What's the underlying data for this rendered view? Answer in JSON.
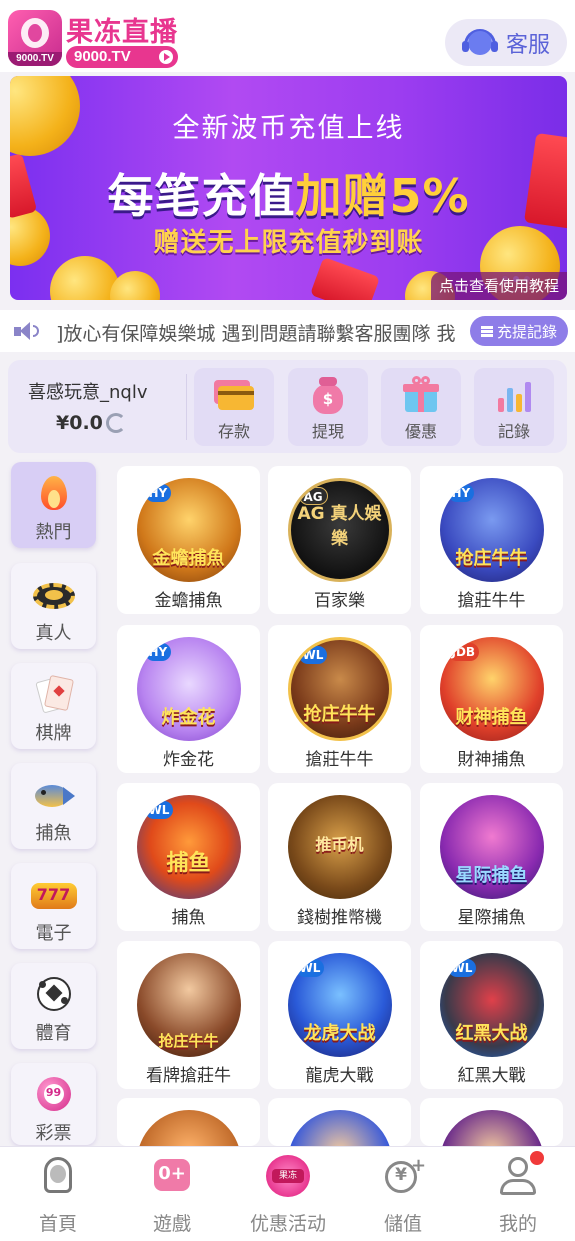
{
  "header": {
    "logo_tag": "9000.TV",
    "logo_title": "果冻直播",
    "logo_subtitle": "9000.TV",
    "customer_service_label": "客服"
  },
  "banner": {
    "line1": "全新波币充值上线",
    "line2_a": "每笔充值",
    "line2_b": "加赠5%",
    "line3": "赠送无上限充值秒到账",
    "link": "点击查看使用教程"
  },
  "marquee": {
    "text": "]放心有保障娛樂城  遇到問題請聯繫客服團隊 我",
    "record_button": "充提記錄"
  },
  "user": {
    "name": "喜感玩意_nqlv",
    "balance": "¥0.0"
  },
  "actions": [
    {
      "label": "存款",
      "icon": "deposit-card-icon"
    },
    {
      "label": "提現",
      "icon": "withdraw-bag-icon"
    },
    {
      "label": "優惠",
      "icon": "gift-icon"
    },
    {
      "label": "記錄",
      "icon": "bar-chart-icon"
    }
  ],
  "categories": [
    {
      "label": "熱門",
      "icon": "flame-icon"
    },
    {
      "label": "真人",
      "icon": "poker-chip-icon"
    },
    {
      "label": "棋牌",
      "icon": "playing-card-icon"
    },
    {
      "label": "捕魚",
      "icon": "shark-icon"
    },
    {
      "label": "電子",
      "icon": "slot-777-icon"
    },
    {
      "label": "體育",
      "icon": "soccer-ball-icon"
    },
    {
      "label": "彩票",
      "icon": "lottery-ball-icon"
    }
  ],
  "games": [
    {
      "name": "金蟾捕魚",
      "badge": "HY",
      "art_title": "金蟾捕魚"
    },
    {
      "name": "百家樂",
      "badge": "AG",
      "art_title": "AG 真人娛樂"
    },
    {
      "name": "搶莊牛牛",
      "badge": "HY",
      "art_title": "抢庄牛牛"
    },
    {
      "name": "炸金花",
      "badge": "HY",
      "art_title": "炸金花"
    },
    {
      "name": "搶莊牛牛",
      "badge": "WL",
      "art_title": "抢庄牛牛"
    },
    {
      "name": "財神捕魚",
      "badge": "JDB",
      "art_title": "财神捕鱼"
    },
    {
      "name": "捕魚",
      "badge": "WL",
      "art_title": "捕鱼"
    },
    {
      "name": "錢樹推幣機",
      "badge": "",
      "art_title": "推币机"
    },
    {
      "name": "星際捕魚",
      "badge": "",
      "art_title": "星际捕鱼"
    },
    {
      "name": "看牌搶莊牛",
      "badge": "",
      "art_title": "抢庄牛牛"
    },
    {
      "name": "龍虎大戰",
      "badge": "WL",
      "art_title": "龙虎大战"
    },
    {
      "name": "紅黑大戰",
      "badge": "WL",
      "art_title": "红黑大战"
    }
  ],
  "bottom_nav": [
    {
      "label": "首頁",
      "icon": "home-portrait-icon"
    },
    {
      "label": "遊戲",
      "icon": "gamepad-icon"
    },
    {
      "label": "优惠活动",
      "icon": "promo-logo-icon"
    },
    {
      "label": "儲值",
      "icon": "yuan-plus-icon"
    },
    {
      "label": "我的",
      "icon": "user-icon"
    }
  ],
  "colors": {
    "brand_pink": "#e8368f",
    "accent_purple": "#8e7de8",
    "banner_gold": "#ffcf3a"
  }
}
